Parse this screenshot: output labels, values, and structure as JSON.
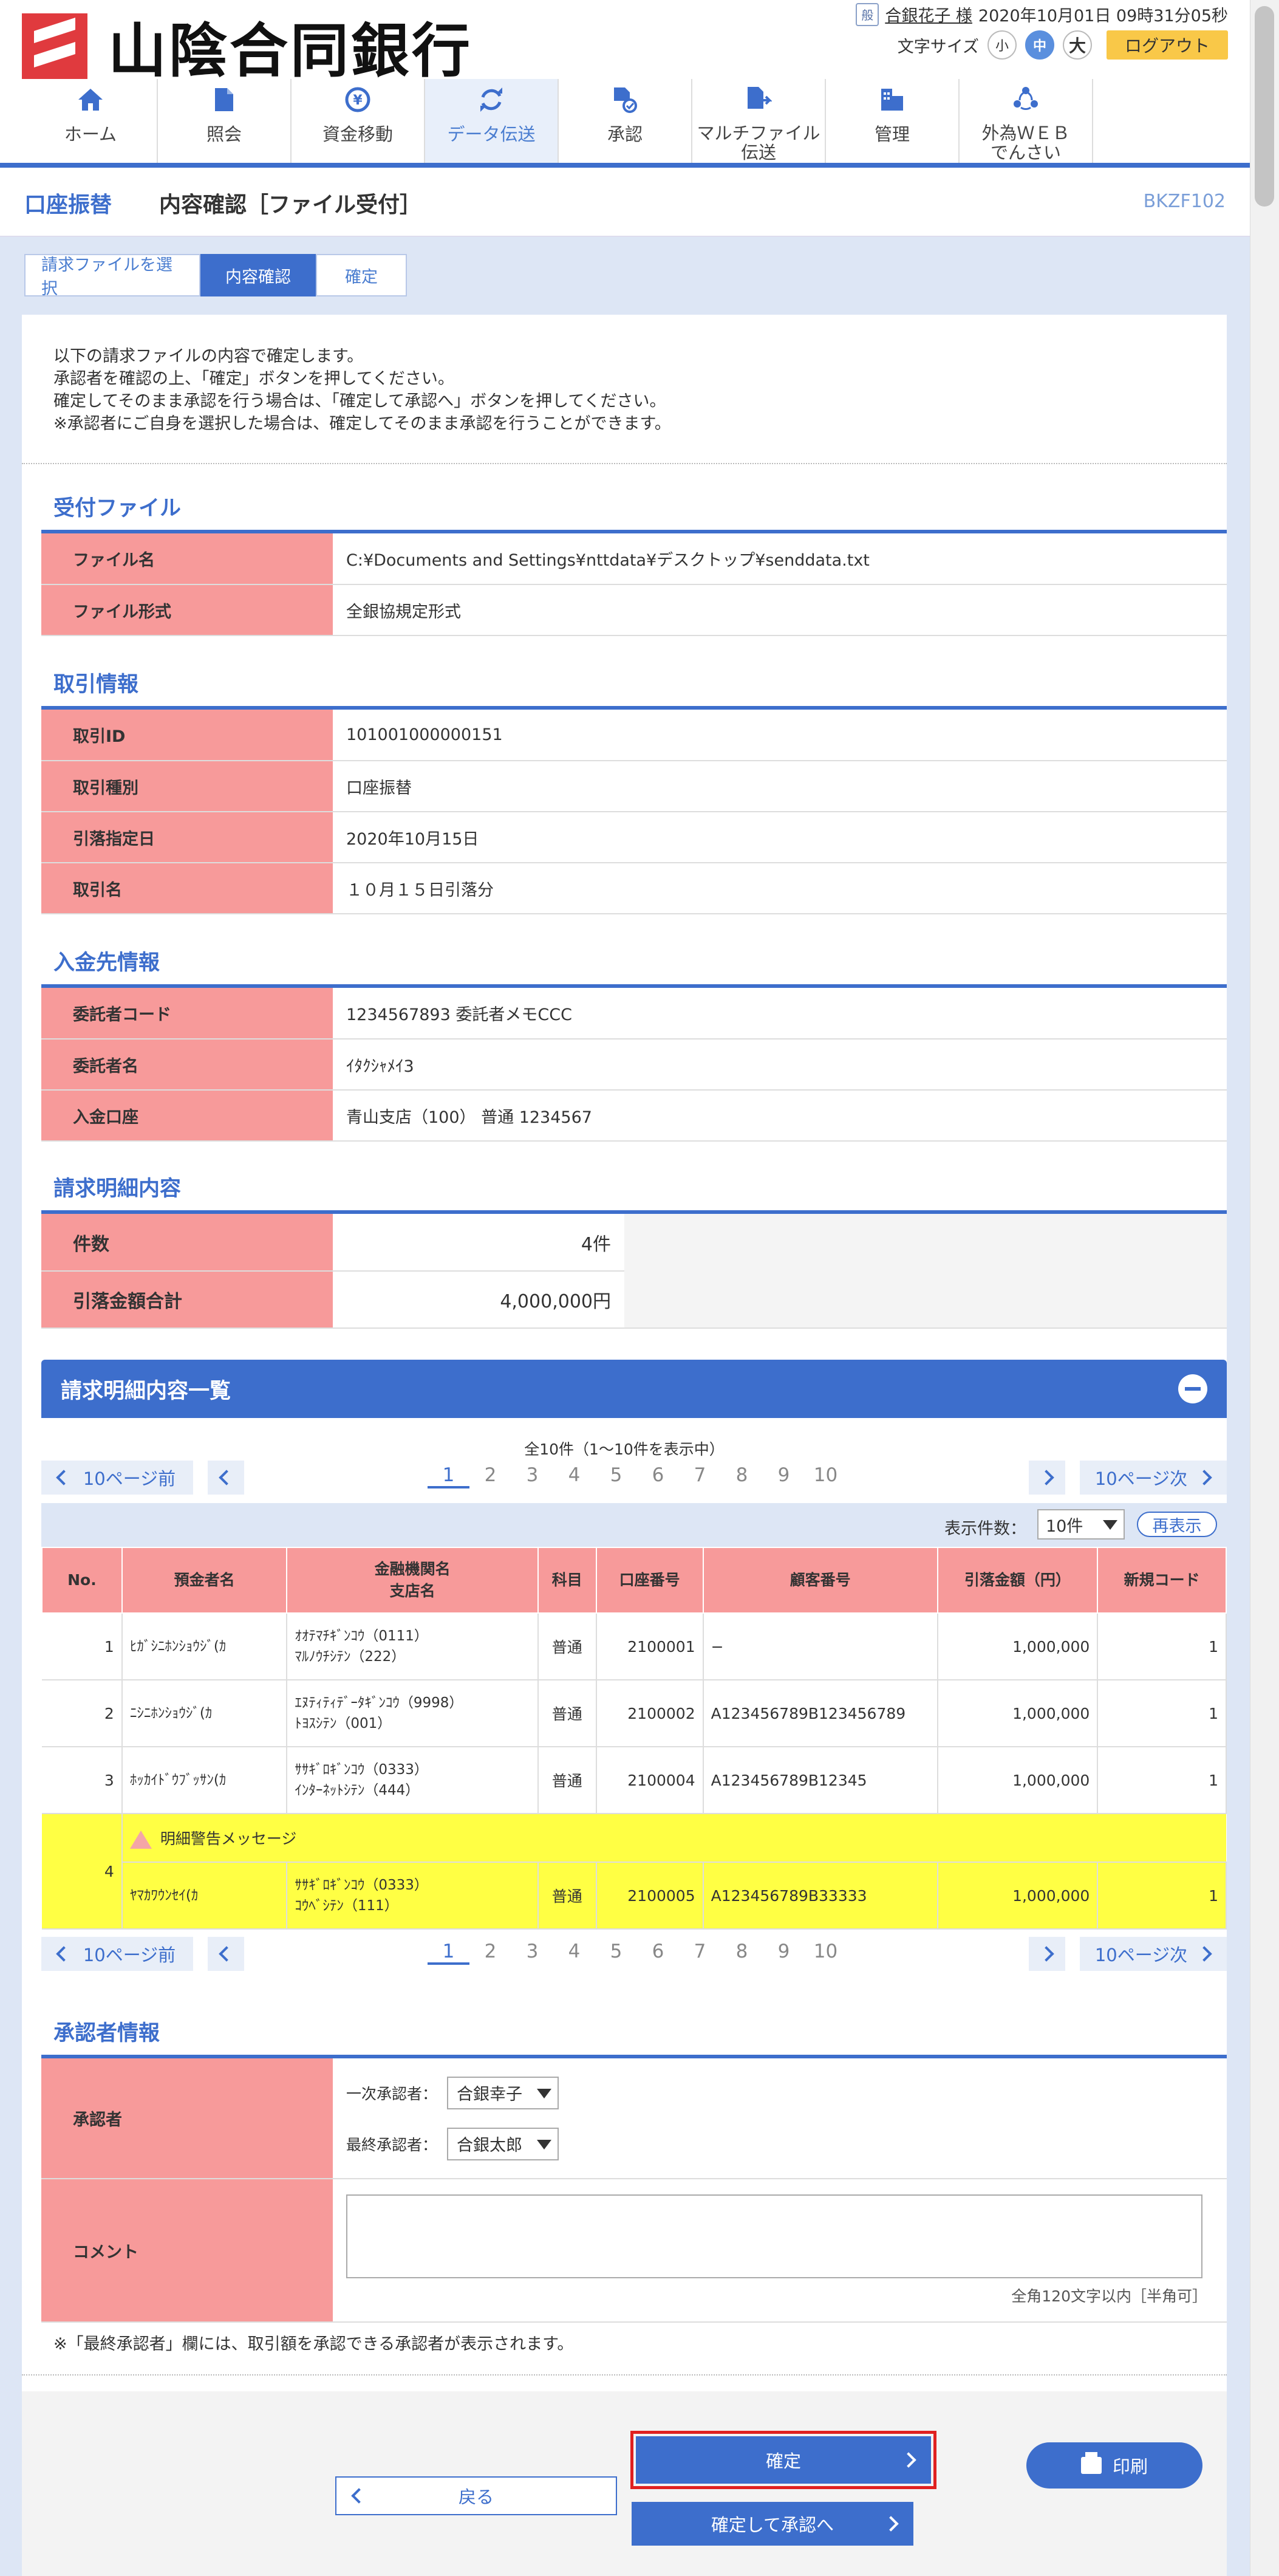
{
  "header": {
    "bank_name": "山陰合同銀行",
    "user_name": "合銀花子 様",
    "user_icon_label": "般",
    "datetime": "2020年10月01日 09時31分05秒",
    "font_size_label": "文字サイズ",
    "font_sizes": [
      "小",
      "中",
      "大"
    ],
    "logout_label": "ログアウト"
  },
  "nav": [
    {
      "label": "ホーム",
      "icon": "home-icon"
    },
    {
      "label": "照会",
      "icon": "document-icon"
    },
    {
      "label": "資金移動",
      "icon": "yen-transfer-icon"
    },
    {
      "label": "データ伝送",
      "icon": "sync-icon"
    },
    {
      "label": "承認",
      "icon": "approve-icon"
    },
    {
      "label": "マルチファイル\n伝送",
      "icon": "multi-file-icon"
    },
    {
      "label": "管理",
      "icon": "building-icon"
    },
    {
      "label": "外為ＷＥＢ\nでんさい",
      "icon": "globe-icon"
    }
  ],
  "page": {
    "category": "口座振替",
    "title": "内容確認［ファイル受付］",
    "screen_id": "BKZF102"
  },
  "steps": [
    "請求ファイルを選択",
    "内容確認",
    "確定"
  ],
  "intro": [
    "以下の請求ファイルの内容で確定します。",
    "承認者を確認の上、「確定」ボタンを押してください。",
    "確定してそのまま承認を行う場合は、「確定して承認へ」ボタンを押してください。",
    "※承認者にご自身を選択した場合は、確定してそのまま承認を行うことができます。"
  ],
  "received_file": {
    "heading": "受付ファイル",
    "rows": [
      {
        "label": "ファイル名",
        "value": "C:¥Documents and Settings¥nttdata¥デスクトップ¥senddata.txt"
      },
      {
        "label": "ファイル形式",
        "value": "全銀協規定形式"
      }
    ]
  },
  "transaction": {
    "heading": "取引情報",
    "rows": [
      {
        "label": "取引ID",
        "value": "101001000000151"
      },
      {
        "label": "取引種別",
        "value": "口座振替"
      },
      {
        "label": "引落指定日",
        "value": "2020年10月15日"
      },
      {
        "label": "取引名",
        "value": "１０月１５日引落分"
      }
    ]
  },
  "deposit": {
    "heading": "入金先情報",
    "rows": [
      {
        "label": "委託者コード",
        "value": "1234567893 委託者メモCCC"
      },
      {
        "label": "委託者名",
        "value": "ｲﾀｸｼｬﾒｲ3"
      },
      {
        "label": "入金口座",
        "value": "青山支店（100） 普通 1234567"
      }
    ]
  },
  "summary": {
    "heading": "請求明細内容",
    "rows": [
      {
        "label": "件数",
        "value": "4件"
      },
      {
        "label": "引落金額合計",
        "value": "4,000,000円"
      }
    ]
  },
  "detail_list": {
    "heading": "請求明細内容一覧",
    "count_info": "全10件（1〜10件を表示中）",
    "prev10": "10ページ前",
    "next10": "10ページ次",
    "pages": [
      "1",
      "2",
      "3",
      "4",
      "5",
      "6",
      "7",
      "8",
      "9",
      "10"
    ],
    "display_count_label": "表示件数：",
    "display_count": "10件",
    "reshow_label": "再表示",
    "columns": [
      "No.",
      "預金者名",
      "金融機関名\n支店名",
      "科目",
      "口座番号",
      "顧客番号",
      "引落金額（円）",
      "新規コード"
    ],
    "rows": [
      {
        "no": "1",
        "name": "ﾋｶﾞｼﾆﾎﾝｼｮｳｼﾞ(ｶ",
        "bank": "ｵｵﾃﾏﾁｷﾞﾝｺｳ（0111）",
        "branch": "ﾏﾙﾉｳﾁｼﾃﾝ（222）",
        "type": "普通",
        "account": "2100001",
        "customer": "−",
        "amount": "1,000,000",
        "code": "1"
      },
      {
        "no": "2",
        "name": "ﾆｼﾆﾎﾝｼｮｳｼﾞ(ｶ",
        "bank": "ｴﾇﾃｨﾃｨﾃﾞｰﾀｷﾞﾝｺｳ（9998）",
        "branch": "ﾄﾖｽｼﾃﾝ（001）",
        "type": "普通",
        "account": "2100002",
        "customer": "A123456789B123456789",
        "amount": "1,000,000",
        "code": "1"
      },
      {
        "no": "3",
        "name": "ﾎｯｶｲﾄﾞｳﾌﾞｯｻﾝ(ｶ",
        "bank": "ｻｻｷﾞﾛｷﾞﾝｺｳ（0333）",
        "branch": "ｲﾝﾀｰﾈｯﾄｼﾃﾝ（444）",
        "type": "普通",
        "account": "2100004",
        "customer": "A123456789B12345",
        "amount": "1,000,000",
        "code": "1"
      },
      {
        "no": "4",
        "warning": "明細警告メッセージ",
        "name": "ﾔﾏｶﾜｳﾝｾｲ(ｶ",
        "bank": "ｻｻｷﾞﾛｷﾞﾝｺｳ（0333）",
        "branch": "ｺｳﾍﾞｼﾃﾝ（111）",
        "type": "普通",
        "account": "2100005",
        "customer": "A123456789B33333",
        "amount": "1,000,000",
        "code": "1"
      }
    ]
  },
  "approver": {
    "heading": "承認者情報",
    "label": "承認者",
    "first_label": "一次承認者：",
    "first_value": "合銀幸子",
    "final_label": "最終承認者：",
    "final_value": "合銀太郎",
    "comment_label": "コメント",
    "comment_value": "",
    "comment_note": "全角120文字以内［半角可］",
    "note": "※「最終承認者」欄には、取引額を承認できる承認者が表示されます。"
  },
  "buttons": {
    "confirm": "確定",
    "back": "戻る",
    "print": "印刷",
    "confirm_approve": "確定して承認へ"
  },
  "colors": {
    "primary": "#3d6ecc",
    "label_bg": "#f79a9a",
    "warning_row": "#ffff44",
    "logout": "#f9c848",
    "highlight_border": "#e02020"
  }
}
